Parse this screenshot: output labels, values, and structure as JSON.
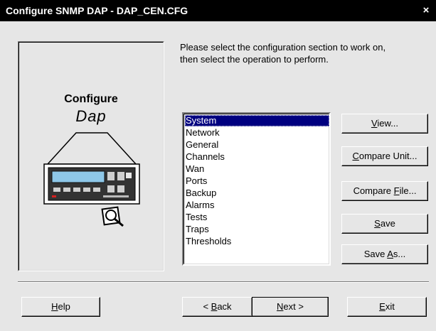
{
  "window": {
    "title": "Configure SNMP DAP - DAP_CEN.CFG",
    "close_glyph": "×"
  },
  "left_panel": {
    "title": "Configure",
    "subtitle": "Dap"
  },
  "instructions": {
    "line1": "Please select the configuration section to work on,",
    "line2": "then select the operation to perform."
  },
  "sections": [
    "System",
    "Network",
    "General",
    "Channels",
    "Wan",
    "Ports",
    "Backup",
    "Alarms",
    "Tests",
    "Traps",
    "Thresholds"
  ],
  "selected_section": "System",
  "buttons": {
    "view": {
      "before": "",
      "key": "V",
      "after": "iew..."
    },
    "compare_unit": {
      "before": "",
      "key": "C",
      "after": "ompare Unit..."
    },
    "compare_file": {
      "before": "Compare ",
      "key": "F",
      "after": "ile..."
    },
    "save": {
      "before": "",
      "key": "S",
      "after": "ave"
    },
    "save_as": {
      "before": "Save ",
      "key": "A",
      "after": "s..."
    },
    "help": {
      "before": "",
      "key": "H",
      "after": "elp"
    },
    "back": {
      "before": "< ",
      "key": "B",
      "after": "ack"
    },
    "next": {
      "before": "",
      "key": "N",
      "after": "ext >"
    },
    "exit": {
      "before": "",
      "key": "E",
      "after": "xit"
    }
  },
  "colors": {
    "titlebar": "#000000",
    "selection": "#000080",
    "dialog": "#e6e6e6"
  }
}
